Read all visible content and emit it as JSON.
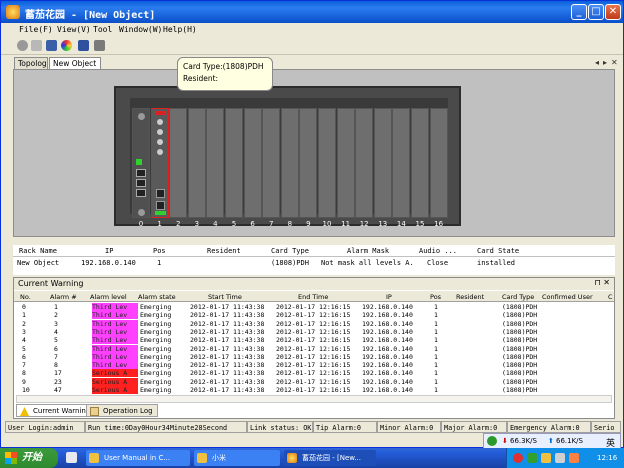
{
  "window": {
    "title": "蓄茄花园 - [New Object]",
    "min": "_",
    "max": "□",
    "close": "✕"
  },
  "menu": [
    "File(F)",
    "View(V)",
    "Tool",
    "Window(W)",
    "Help(H)"
  ],
  "toolbar_icons": [
    "stop-icon",
    "grid-icon",
    "monitor-icon",
    "color-icon",
    "save-icon",
    "print-icon"
  ],
  "tabs": [
    {
      "label": "Topology",
      "active": false
    },
    {
      "label": "New Object",
      "active": true
    }
  ],
  "tooltip": {
    "card_type": "Card Type:(1808)PDH",
    "resident": "Resident:"
  },
  "slot_numbers": [
    "0",
    "1",
    "2",
    "3",
    "4",
    "5",
    "6",
    "7",
    "8",
    "9",
    "10",
    "11",
    "12",
    "13",
    "14",
    "15",
    "16"
  ],
  "card_grid": {
    "headers": [
      "Rack Name",
      "IP",
      "Pos",
      "Resident",
      "Card Type",
      "Alarm Mask",
      "Audio ...",
      "Card State"
    ],
    "row": [
      "New Object",
      "192.168.0.140",
      "1",
      "",
      "(1808)PDH",
      "Not mask all levels A...",
      "Close",
      "installed"
    ]
  },
  "current_warning": {
    "title": "Current Warning",
    "pin": "⊓ ✕",
    "headers": [
      "No.",
      "Alarm #",
      "Alarm level",
      "Alarm state",
      "Start Time",
      "End Time",
      "IP",
      "Pos",
      "Resident",
      "Card Type",
      "Confirmed User",
      "C"
    ],
    "rows": [
      {
        "no": "0",
        "alarm": "1",
        "level": "Third Lev",
        "state": "Emerging",
        "start": "2012-01-17 11:43:38",
        "end": "2012-01-17 12:16:15",
        "ip": "192.168.0.140",
        "pos": "1",
        "card": "(1808)PDH",
        "color": "#ff40ff"
      },
      {
        "no": "1",
        "alarm": "2",
        "level": "Third Lev",
        "state": "Emerging",
        "start": "2012-01-17 11:43:38",
        "end": "2012-01-17 12:16:15",
        "ip": "192.168.0.140",
        "pos": "1",
        "card": "(1808)PDH",
        "color": "#ff40ff"
      },
      {
        "no": "2",
        "alarm": "3",
        "level": "Third Lev",
        "state": "Emerging",
        "start": "2012-01-17 11:43:38",
        "end": "2012-01-17 12:16:15",
        "ip": "192.168.0.140",
        "pos": "1",
        "card": "(1808)PDH",
        "color": "#ff40ff"
      },
      {
        "no": "3",
        "alarm": "4",
        "level": "Third Lev",
        "state": "Emerging",
        "start": "2012-01-17 11:43:38",
        "end": "2012-01-17 12:16:15",
        "ip": "192.168.0.140",
        "pos": "1",
        "card": "(1808)PDH",
        "color": "#ff40ff"
      },
      {
        "no": "4",
        "alarm": "5",
        "level": "Third Lev",
        "state": "Emerging",
        "start": "2012-01-17 11:43:38",
        "end": "2012-01-17 12:16:15",
        "ip": "192.168.0.140",
        "pos": "1",
        "card": "(1808)PDH",
        "color": "#ff40ff"
      },
      {
        "no": "5",
        "alarm": "6",
        "level": "Third Lev",
        "state": "Emerging",
        "start": "2012-01-17 11:43:38",
        "end": "2012-01-17 12:16:15",
        "ip": "192.168.0.140",
        "pos": "1",
        "card": "(1808)PDH",
        "color": "#ff40ff"
      },
      {
        "no": "6",
        "alarm": "7",
        "level": "Third Lev",
        "state": "Emerging",
        "start": "2012-01-17 11:43:38",
        "end": "2012-01-17 12:16:15",
        "ip": "192.168.0.140",
        "pos": "1",
        "card": "(1808)PDH",
        "color": "#ff40ff"
      },
      {
        "no": "7",
        "alarm": "8",
        "level": "Third Lev",
        "state": "Emerging",
        "start": "2012-01-17 11:43:38",
        "end": "2012-01-17 12:16:15",
        "ip": "192.168.0.140",
        "pos": "1",
        "card": "(1808)PDH",
        "color": "#ff40ff"
      },
      {
        "no": "8",
        "alarm": "17",
        "level": "Serious A",
        "state": "Emerging",
        "start": "2012-01-17 11:43:38",
        "end": "2012-01-17 12:16:15",
        "ip": "192.168.0.140",
        "pos": "1",
        "card": "(1808)PDH",
        "color": "#ff2020"
      },
      {
        "no": "9",
        "alarm": "23",
        "level": "Serious A",
        "state": "Emerging",
        "start": "2012-01-17 11:43:38",
        "end": "2012-01-17 12:16:15",
        "ip": "192.168.0.140",
        "pos": "1",
        "card": "(1808)PDH",
        "color": "#ff2020"
      },
      {
        "no": "10",
        "alarm": "47",
        "level": "Serious A",
        "state": "Emerging",
        "start": "2012-01-17 11:43:38",
        "end": "2012-01-17 12:16:15",
        "ip": "192.168.0.140",
        "pos": "1",
        "card": "(1808)PDH",
        "color": "#ff2020"
      }
    ],
    "tabs": [
      "Current Warning",
      "Operation Log"
    ]
  },
  "statusbar": [
    "User Login:admin",
    "Run time:0Day0Hour34Minute28Second",
    "Link status: OK",
    "Tip Alarm:0",
    "Minor Alarm:0",
    "Major Alarm:0",
    "Emergency Alarm:0",
    "Serio"
  ],
  "net": {
    "up": "66.3K/S",
    "down": "66.1K/S",
    "lang": "英"
  },
  "taskbar": {
    "start": "开始",
    "items": [
      "User Manual in C...",
      "小米",
      "蓄茄花园 - [New..."
    ],
    "clock": "12:16"
  }
}
